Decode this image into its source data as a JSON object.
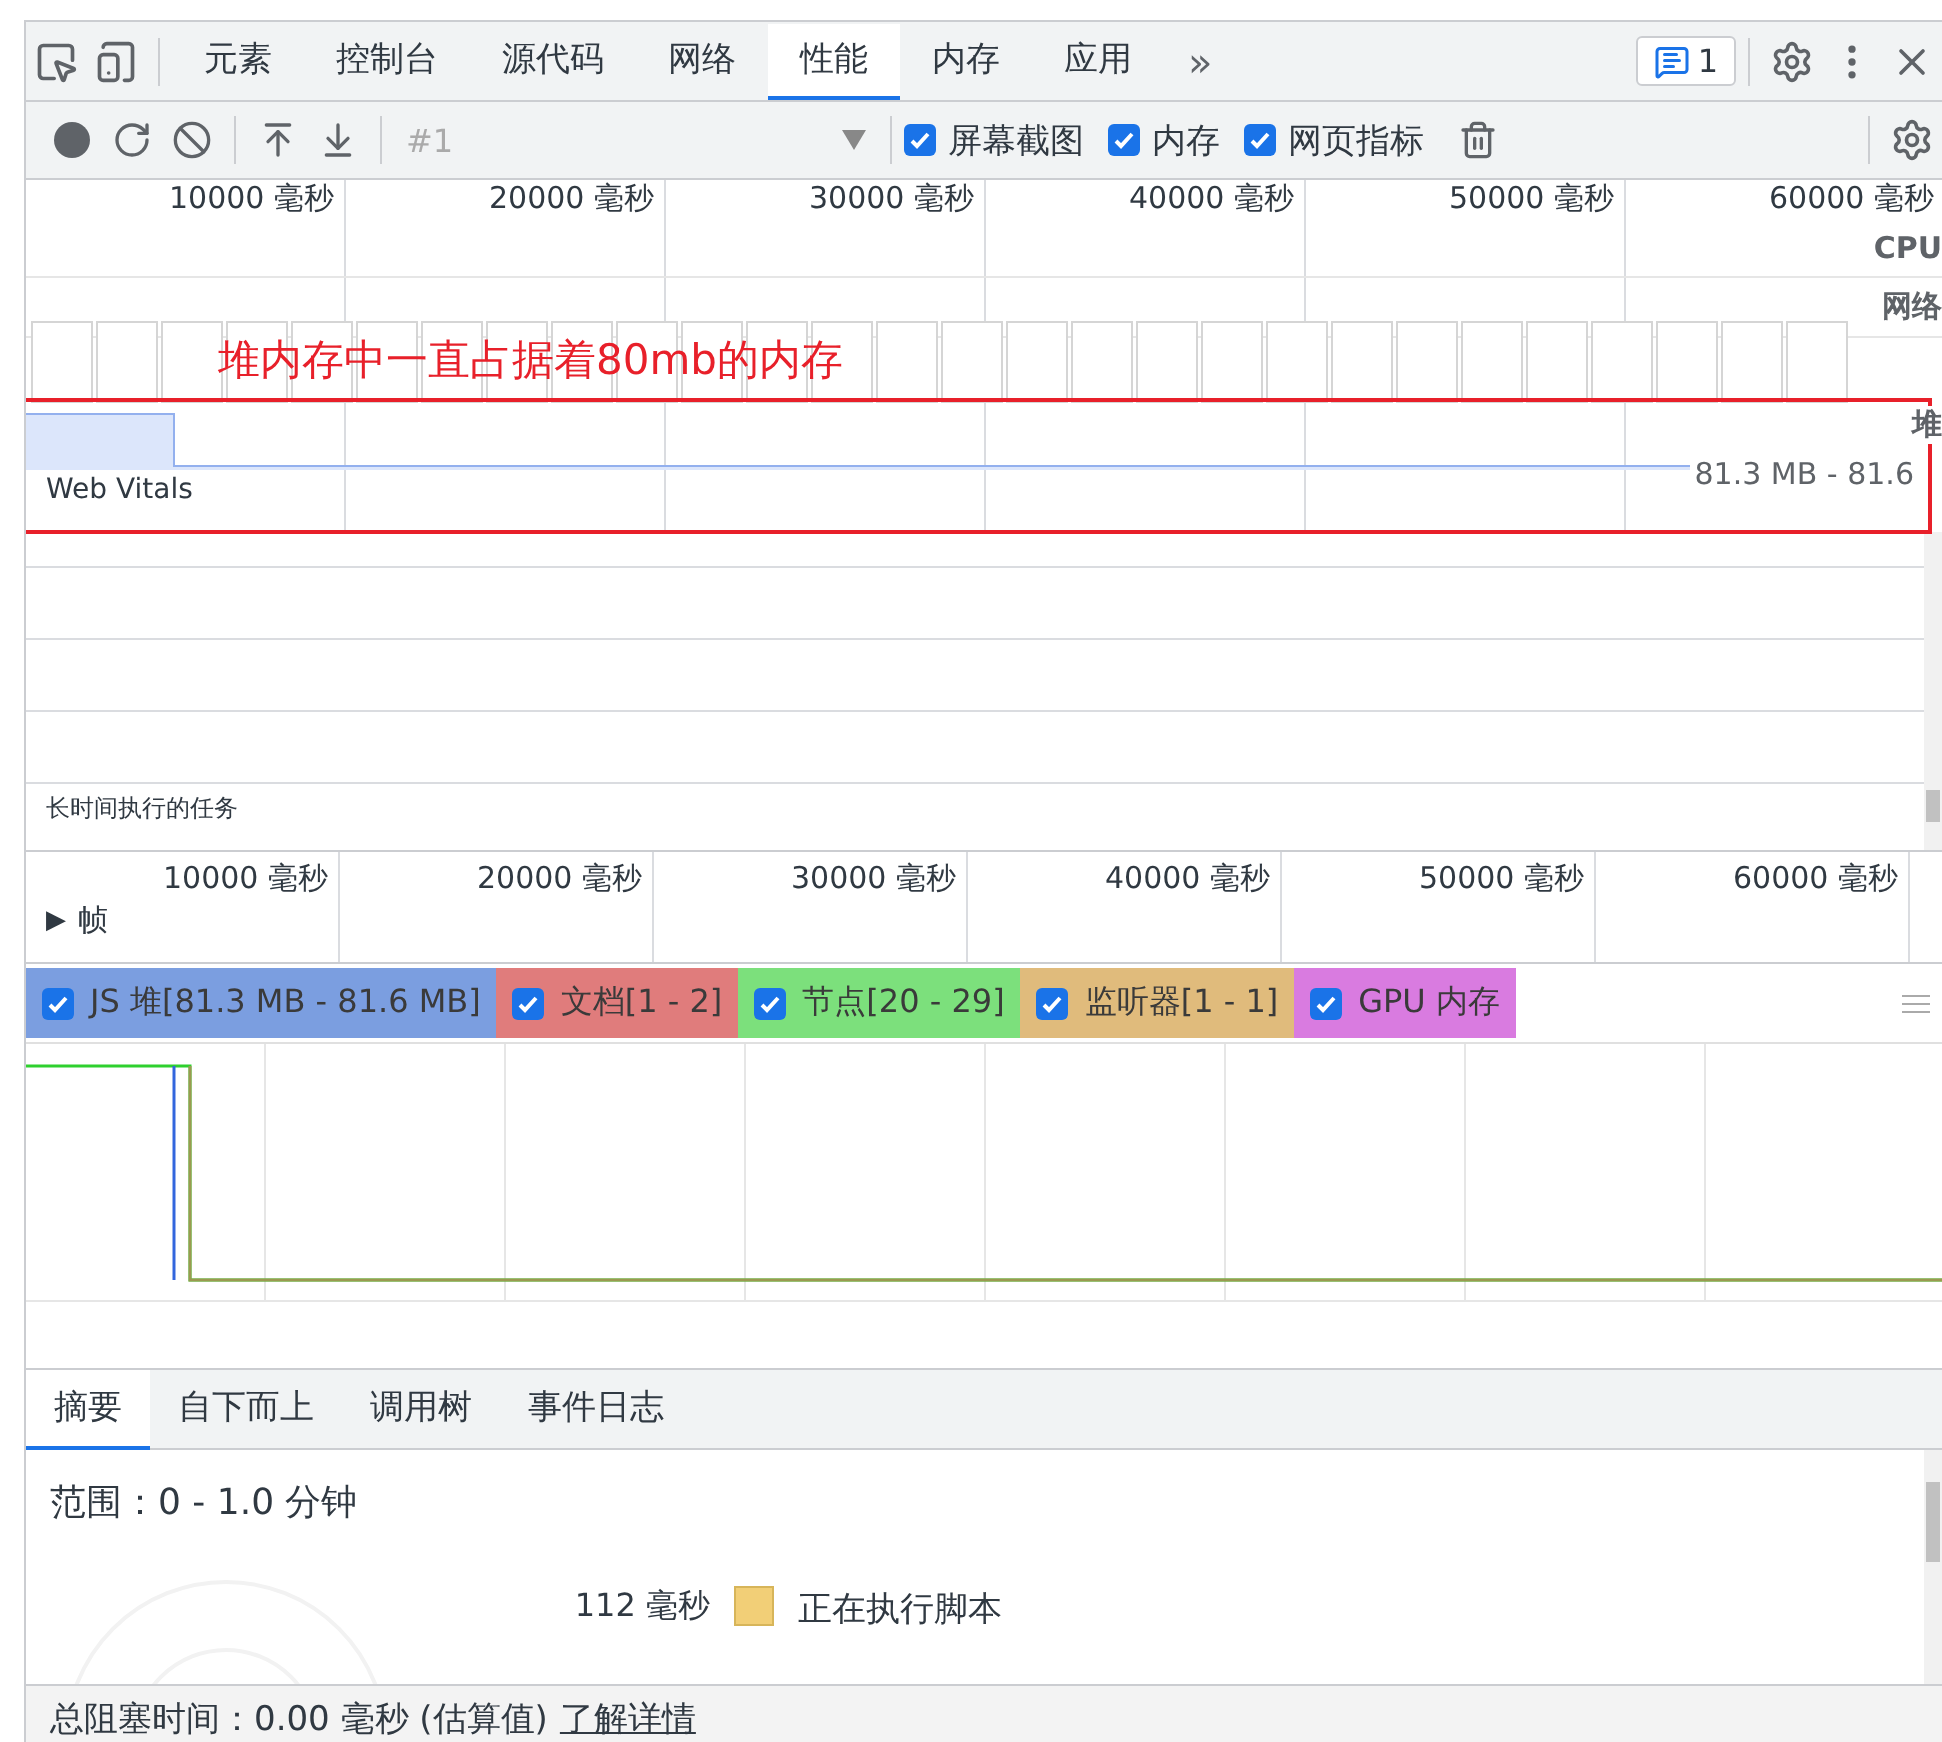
{
  "tabs": [
    {
      "label": "元素",
      "selected": false
    },
    {
      "label": "控制台",
      "selected": false
    },
    {
      "label": "源代码",
      "selected": false
    },
    {
      "label": "网络",
      "selected": false
    },
    {
      "label": "性能",
      "selected": true
    },
    {
      "label": "内存",
      "selected": false
    },
    {
      "label": "应用",
      "selected": false
    }
  ],
  "more_tabs": "»",
  "issues_count": "1",
  "recording_toolbar": {
    "profile_select": "#1",
    "checkboxes": [
      {
        "label": "屏幕截图",
        "checked": true
      },
      {
        "label": "内存",
        "checked": true
      },
      {
        "label": "网页指标",
        "checked": true
      }
    ]
  },
  "overview": {
    "ticks": [
      "10000 毫秒",
      "20000 毫秒",
      "30000 毫秒",
      "40000 毫秒",
      "50000 毫秒",
      "60000 毫秒"
    ],
    "lane_labels": [
      "CPU",
      "网络",
      "堆"
    ],
    "heap_range": "81.3 MB - 81.6"
  },
  "annotation": "堆内存中一直占据着80mb的内存",
  "tracks": {
    "web_vitals": "Web Vitals",
    "long_tasks": "长时间执行的任务"
  },
  "timeline": {
    "ticks": [
      "10000 毫秒",
      "20000 毫秒",
      "30000 毫秒",
      "40000 毫秒",
      "50000 毫秒",
      "60000 毫秒"
    ],
    "frames_toggle": "▶",
    "frames_label": "帧"
  },
  "counters": [
    {
      "label": "JS 堆[81.3 MB - 81.6 MB]",
      "checked": true,
      "color": "#7b9ee0"
    },
    {
      "label": "文档[1 - 2]",
      "checked": true,
      "color": "#e07c7c"
    },
    {
      "label": "节点[20 - 29]",
      "checked": true,
      "color": "#7ce07c"
    },
    {
      "label": "监听器[1 - 1]",
      "checked": true,
      "color": "#e0bb7c"
    },
    {
      "label": "GPU 内存",
      "checked": true,
      "color": "#d97be0"
    }
  ],
  "details_tabs": [
    {
      "label": "摘要",
      "selected": true
    },
    {
      "label": "自下而上",
      "selected": false
    },
    {
      "label": "调用树",
      "selected": false
    },
    {
      "label": "事件日志",
      "selected": false
    }
  ],
  "summary": {
    "range": "范围：0 - 1.0 分钟",
    "rows": [
      {
        "time": "112 毫秒",
        "label": "正在执行脚本",
        "color": "#f2cf77"
      }
    ]
  },
  "footer": {
    "text": "总阻塞时间：0.00 毫秒 (估算值)",
    "link": "了解详情"
  }
}
